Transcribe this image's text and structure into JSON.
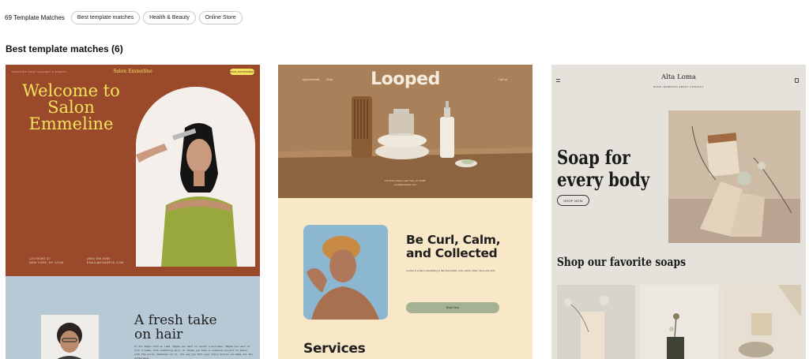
{
  "filters": {
    "result_count": "69 Template Matches",
    "chips": [
      "Best template matches",
      "Health & Beauty",
      "Online Store"
    ]
  },
  "section": {
    "title": "Best template matches (6)"
  },
  "templates": [
    {
      "brand": "Salon Emmeline",
      "nav": "SERVICES     SHOP     GALLERY & EVENTS",
      "cta": "BOOK APPOINTMENT",
      "headline": "Welcome to Salon Emmeline",
      "address_lines": [
        "123 DEMO ST",
        "NEW YORK, NY 12345"
      ],
      "contact_lines": [
        "(555) 555-5555",
        "EMAIL@EXAMPLE.COM"
      ],
      "subheadline": "A fresh take on hair",
      "body": "It all began with an idea. Maybe you want to launch a business. Maybe you want to turn a hobby into something more. Or maybe you have a creative project to share with the world. Whatever it is, the way you tell your story online can make all the difference.",
      "colors": {
        "primary": "#9a4a2b",
        "accent": "#f2e25c",
        "secondary": "#b8c9d6"
      }
    },
    {
      "brand": "Looped",
      "nav_left": [
        "Appointments",
        "Shop"
      ],
      "nav_right": "Call Us",
      "address_lines": [
        "123 Demo Street, New York, NY 12345",
        "email@example.com"
      ],
      "headline": "Be Curl, Calm, and Collected",
      "text": "Looped is a salon specializing in hair that spirals, coils, waves, kinks, loops and curls.",
      "button": "Book Now",
      "section": "Services",
      "colors": {
        "primary": "#a88059",
        "secondary": "#f9e8c8",
        "button": "#a4b293"
      }
    },
    {
      "brand": "Alta Loma",
      "nav": "SHOP     LEARNING     ABOUT     CONTACT",
      "headline": "Soap for every body",
      "button": "SHOP NOW",
      "subheadline": "Shop our favorite soaps",
      "colors": {
        "background": "#e4e2db"
      }
    }
  ]
}
